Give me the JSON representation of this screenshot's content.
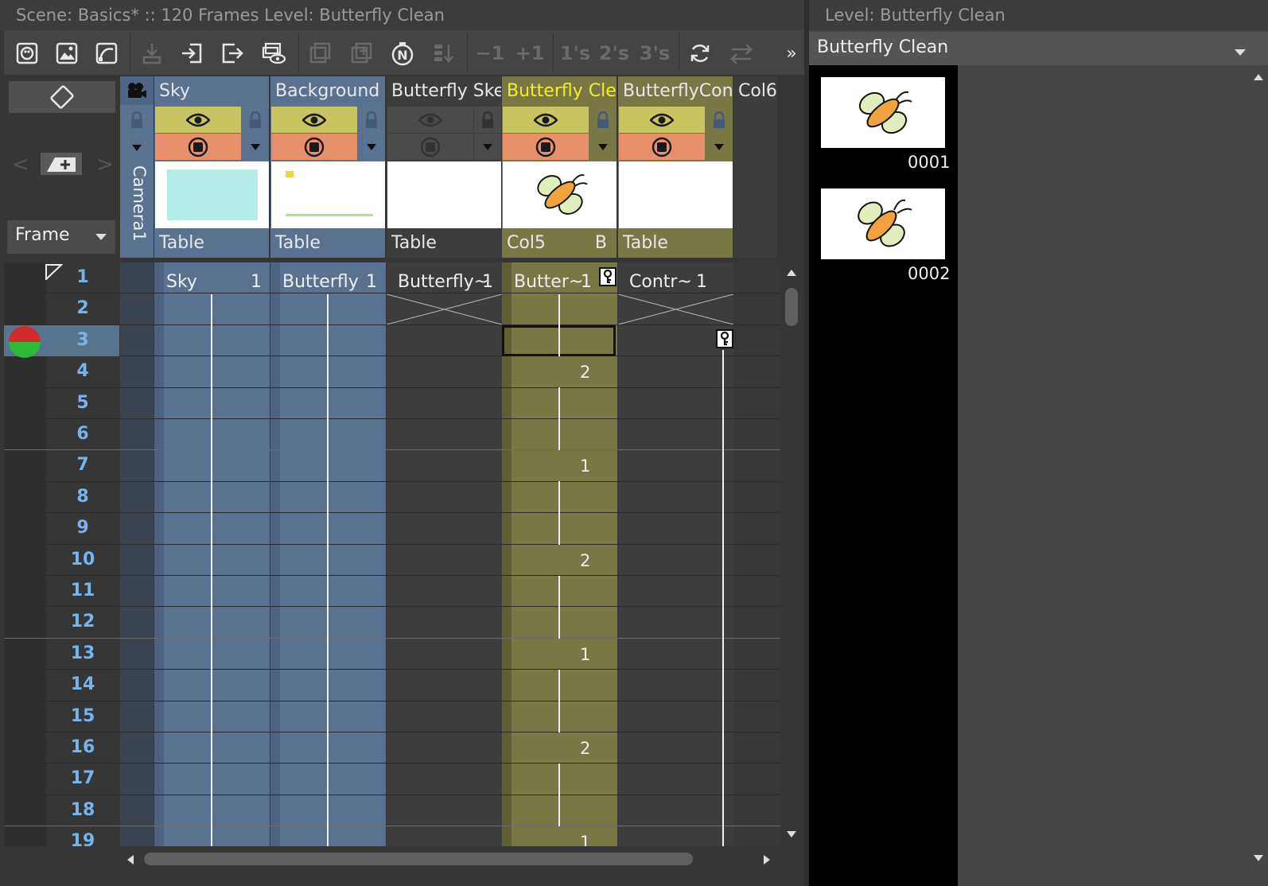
{
  "xsheet": {
    "title": "Scene: Basics*   ::   120 Frames   Level: Butterfly Clean",
    "toolbar": {
      "minus_one": "−1",
      "plus_one": "+1",
      "ones": "1's",
      "twos": "2's",
      "threes": "3's",
      "more": "»"
    },
    "left_panel": {
      "frame_dropdown": "Frame",
      "camera_label": "Camera1"
    },
    "columns": [
      {
        "name": "Sky",
        "footer": "Table",
        "cell_label": "Sky",
        "cell_value": "1"
      },
      {
        "name": "Background",
        "footer": "Table",
        "cell_label": "Butterfly",
        "cell_value": "1"
      },
      {
        "name": "Butterfly Sket",
        "footer": "Table",
        "cell_label": "Butterfly~",
        "cell_value": "1"
      },
      {
        "name": "Butterfly Clea",
        "footer": "Col5",
        "footer_extra": "B",
        "cell_label": "Butter~",
        "cell_value": "1"
      },
      {
        "name": "ButterflyCont",
        "footer": "Table",
        "cell_label": "Contr~",
        "cell_value": "1"
      },
      {
        "name": "Col6"
      }
    ],
    "rows": [
      "1",
      "2",
      "3",
      "4",
      "5",
      "6",
      "7",
      "8",
      "9",
      "10",
      "11",
      "12",
      "13",
      "14",
      "15",
      "16",
      "17",
      "18",
      "19"
    ],
    "current_row": "3",
    "col5_marks": [
      "2",
      "1",
      "2",
      "1",
      "2",
      "1"
    ]
  },
  "level_strip": {
    "title": "Level:  Butterfly Clean",
    "dropdown": "Butterfly Clean",
    "frames": [
      {
        "label": "0001"
      },
      {
        "label": "0002"
      }
    ]
  },
  "colors": {
    "blue_column": "#5b7190",
    "olive_column": "#797744",
    "current_row": "#57748f",
    "frame_number": "#76b4ec",
    "preview_toggle": "#c8c462",
    "camstand_toggle": "#e8906c",
    "selected_column_name": "#f2ef29"
  }
}
